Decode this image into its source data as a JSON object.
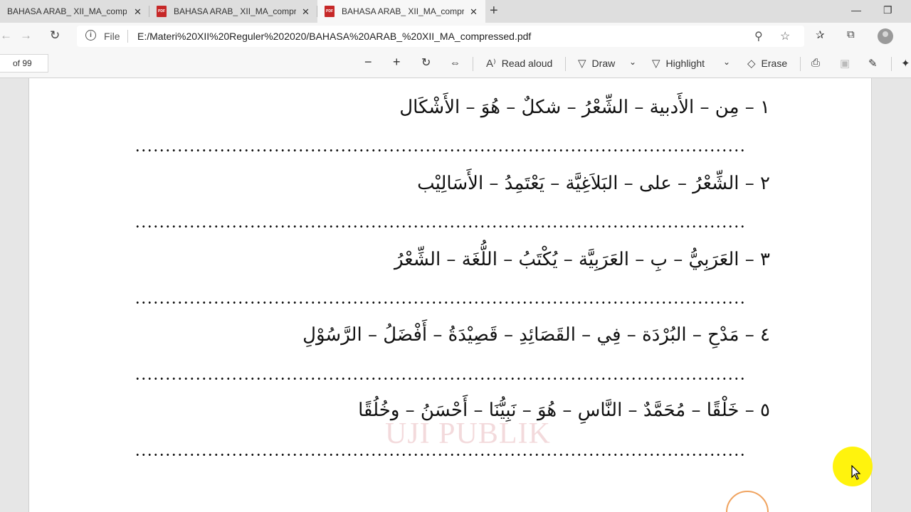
{
  "tabs": [
    {
      "title": "BAHASA ARAB_ XII_MA_compressed.pdf",
      "close": "✕"
    },
    {
      "title": "BAHASA ARAB_ XII_MA_compressed.pdf",
      "close": "✕"
    },
    {
      "title": "BAHASA ARAB_ XII_MA_compressed.pdf",
      "close": "✕"
    }
  ],
  "pdf_badge": "PDF",
  "new_tab": "+",
  "window": {
    "minimize": "—",
    "restore": "❐"
  },
  "nav": {
    "back": "←",
    "forward": "→",
    "refresh": "↻"
  },
  "address": {
    "scheme_label": "File",
    "url": "E:/Materi%20XII%20Reguler%202020/BAHASA%20ARAB_%20XII_MA_compressed.pdf"
  },
  "pdf_toolbar": {
    "page_of": "of 99",
    "zoom_out": "−",
    "zoom_in": "+",
    "rotate": "↻",
    "fit": "⇔",
    "read_aloud": "Read aloud",
    "draw": "Draw",
    "highlight": "Highlight",
    "erase": "Erase"
  },
  "exercises": [
    {
      "number": "١",
      "text": "مِن – الأَدبية – الشِّعْرُ – شكلٌ – هُوَ – الأَشْكَال"
    },
    {
      "number": "٢",
      "text": "الشِّعْرُ – على – البَلاَغِيَّة – يَعْتَمِدُ – الأَسَالِيْب"
    },
    {
      "number": "٣",
      "text": "العَرَبِيُّ – بِ – العَرَبِيَّة – يُكْتَبُ – اللُّغَة – الشِّعْرُ"
    },
    {
      "number": "٤",
      "text": "مَدْحِ – البُرْدَة – فِي – القَصَائِدِ – قَصِيْدَةُ – أَفْضَلُ – الرَّسُوْلِ"
    },
    {
      "number": "٥",
      "text": "خَلْقًا – مُحَمَّدٌ – النَّاسِ – هُوَ – نَبِيُّنَا – أَحْسَنُ – وخُلُقًا"
    }
  ],
  "watermark": "UJI PUBLIK"
}
